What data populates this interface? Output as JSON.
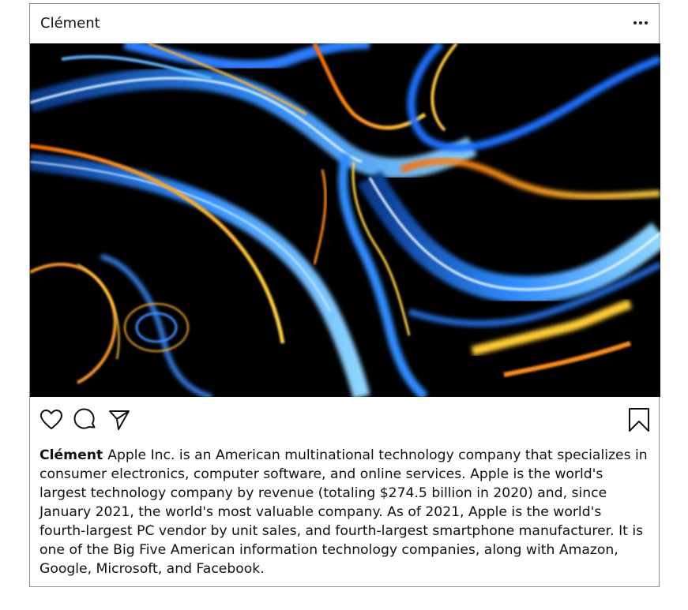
{
  "post": {
    "username": "Clément",
    "more_icon": "more-horizontal-icon",
    "image": {
      "description_icon": "abstract-wallpaper-image",
      "colors": {
        "background": "#000000",
        "blue": "#1e90ff",
        "cyan": "#7fd8ff",
        "orange": "#ff8c1a",
        "yellow": "#ffd23f"
      }
    },
    "actions": {
      "like_icon": "heart-icon",
      "comment_icon": "comment-icon",
      "share_icon": "send-icon",
      "save_icon": "bookmark-icon"
    },
    "caption": {
      "author": "Clément",
      "text": "Apple Inc. is an American multinational technology company that specializes in consumer electronics, computer software, and online services. Apple is the world's largest technology company by revenue (totaling $274.5 billion in 2020) and, since January 2021, the world's most valuable company. As of 2021, Apple is the world's fourth-largest PC vendor by unit sales, and fourth-largest smartphone manufacturer. It is one of the Big Five American information technology companies, along with Amazon, Google, Microsoft, and Facebook."
    }
  }
}
